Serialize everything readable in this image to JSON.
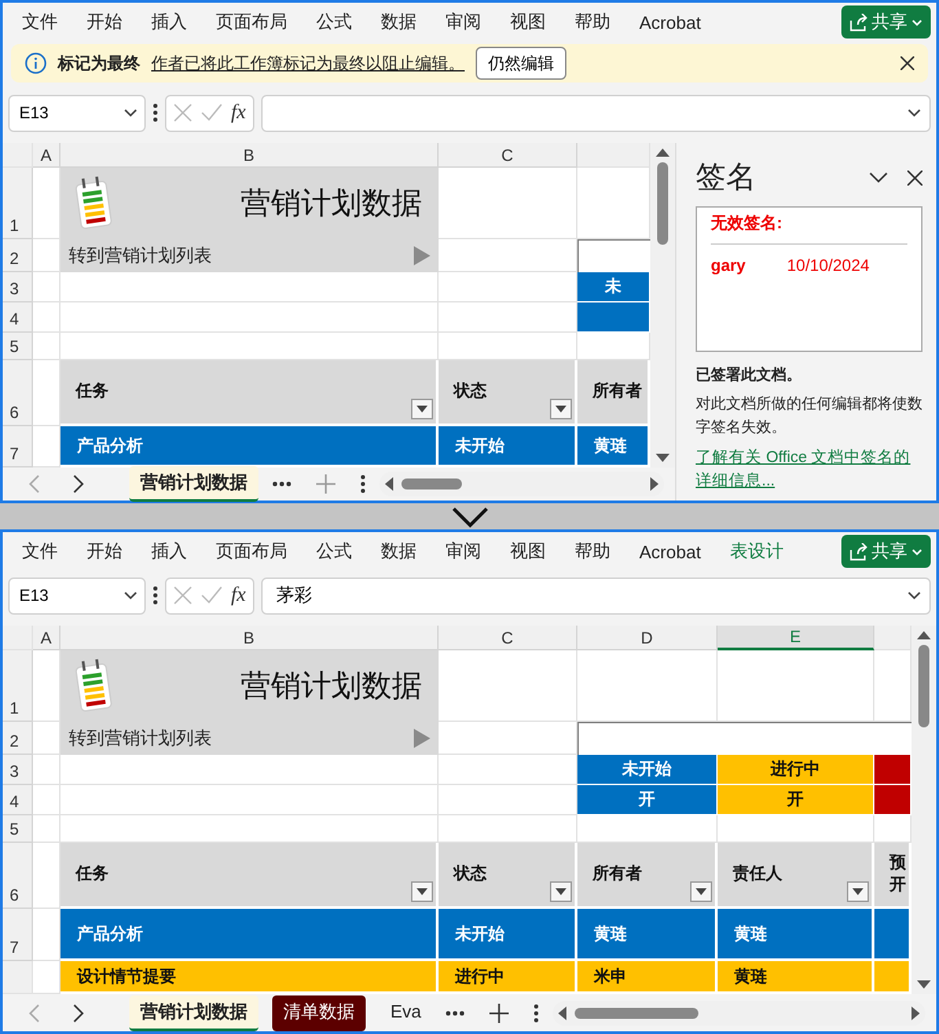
{
  "windows": [
    {
      "ribbon_tabs": [
        {
          "label": "文件",
          "contextual": false
        },
        {
          "label": "开始",
          "contextual": false
        },
        {
          "label": "插入",
          "contextual": false
        },
        {
          "label": "页面布局",
          "contextual": false
        },
        {
          "label": "公式",
          "contextual": false
        },
        {
          "label": "数据",
          "contextual": false
        },
        {
          "label": "审阅",
          "contextual": false
        },
        {
          "label": "视图",
          "contextual": false
        },
        {
          "label": "帮助",
          "contextual": false
        },
        {
          "label": "Acrobat",
          "contextual": false
        }
      ],
      "share_button": "共享",
      "message_bar": {
        "title": "标记为最终",
        "text": "作者已将此工作簿标记为最终以阻止编辑。",
        "button": "仍然编辑"
      },
      "formula_bar": {
        "name_box": "E13",
        "function_label": "fx"
      },
      "sheet": {
        "columns": [
          {
            "label": "A",
            "selected": false
          },
          {
            "label": "B",
            "selected": false
          },
          {
            "label": "C",
            "selected": false
          }
        ],
        "row_numbers": [
          "1",
          "2",
          "3",
          "4",
          "5",
          "6",
          "7"
        ],
        "title": "营销计划数据",
        "link": "转到营销计划列表",
        "legend": [
          [
            {
              "text": "未",
              "color": "#0070c0"
            }
          ],
          [
            {
              "color": "#0070c0"
            }
          ]
        ],
        "table": {
          "columns": [
            {
              "label": "任务",
              "filter": true
            },
            {
              "label": "状态",
              "filter": true
            },
            {
              "label": "所有者",
              "filter": false
            }
          ],
          "rows": [
            {
              "color": "#0070c0",
              "cells": [
                "产品分析",
                "未开始",
                "黄琏"
              ]
            }
          ]
        }
      },
      "sheet_tabs": [
        {
          "label": "营销计划数据",
          "selected": true
        }
      ],
      "signature_pane": {
        "title": "签名",
        "invalid_label": "无效签名:",
        "signatures": [
          {
            "signer": "gary",
            "date": "10/10/2024"
          }
        ],
        "status": "已签署此文档。",
        "note": "对此文档所做的任何编辑都将使数字签名失效。",
        "link": "了解有关 Office 文档中签名的详细信息..."
      }
    },
    {
      "ribbon_tabs": [
        {
          "label": "文件",
          "contextual": false
        },
        {
          "label": "开始",
          "contextual": false
        },
        {
          "label": "插入",
          "contextual": false
        },
        {
          "label": "页面布局",
          "contextual": false
        },
        {
          "label": "公式",
          "contextual": false
        },
        {
          "label": "数据",
          "contextual": false
        },
        {
          "label": "审阅",
          "contextual": false
        },
        {
          "label": "视图",
          "contextual": false
        },
        {
          "label": "帮助",
          "contextual": false
        },
        {
          "label": "Acrobat",
          "contextual": false
        },
        {
          "label": "表设计",
          "contextual": true
        }
      ],
      "share_button": "共享",
      "formula_bar": {
        "name_box": "E13",
        "function_label": "fx",
        "value": "茅彩"
      },
      "sheet": {
        "columns": [
          {
            "label": "A",
            "selected": false
          },
          {
            "label": "B",
            "selected": false
          },
          {
            "label": "C",
            "selected": false
          },
          {
            "label": "D",
            "selected": false
          },
          {
            "label": "E",
            "selected": true
          }
        ],
        "row_numbers": [
          "1",
          "2",
          "3",
          "4",
          "5",
          "6",
          "7"
        ],
        "title": "营销计划数据",
        "link": "转到营销计划列表",
        "legend": [
          [
            {
              "text": "未开始",
              "color": "#0070c0"
            },
            {
              "text": "进行中",
              "color": "#ffc000"
            },
            {
              "color": "#c00000"
            }
          ],
          [
            {
              "text": "开",
              "color": "#0070c0"
            },
            {
              "text": "开",
              "color": "#ffc000"
            },
            {
              "color": "#c00000"
            }
          ]
        ],
        "table": {
          "columns": [
            {
              "label": "任务",
              "filter": true
            },
            {
              "label": "状态",
              "filter": true
            },
            {
              "label": "所有者",
              "filter": true
            },
            {
              "label": "责任人",
              "filter": true
            },
            {
              "label": "预开",
              "filter": false
            }
          ],
          "rows": [
            {
              "color": "#0070c0",
              "cells": [
                "产品分析",
                "未开始",
                "黄琏",
                "黄琏"
              ]
            },
            {
              "color": "#ffc000",
              "cells": [
                "设计情节提要",
                "进行中",
                "米申",
                "黄琏"
              ]
            }
          ]
        }
      },
      "sheet_tabs": [
        {
          "label": "营销计划数据",
          "selected": true
        },
        {
          "label": "清单数据",
          "selected": false,
          "color": "#5c0000"
        },
        {
          "label": "Eva",
          "selected": false
        }
      ]
    }
  ]
}
